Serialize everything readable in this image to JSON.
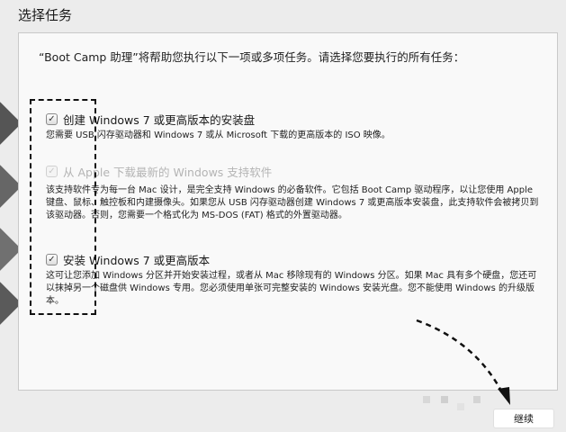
{
  "page": {
    "heading": "选择任务"
  },
  "panel": {
    "intro": "“Boot Camp 助理”将帮助您执行以下一项或多项任务。请选择您要执行的所有任务：",
    "options": [
      {
        "label": "创建 Windows 7 或更高版本的安装盘",
        "checked": true,
        "enabled": true,
        "description": "您需要 USB 闪存驱动器和 Windows 7 或从 Microsoft 下载的更高版本的 ISO 映像。"
      },
      {
        "label": "从 Apple 下载最新的 Windows 支持软件",
        "checked": true,
        "enabled": false,
        "description": "该支持软件专为每一台 Mac 设计，是完全支持 Windows 的必备软件。它包括 Boot Camp 驱动程序，以让您使用 Apple 键盘、鼠标、触控板和内建摄像头。如果您从 USB 闪存驱动器创建 Windows 7 或更高版本安装盘，此支持软件会被拷贝到该驱动器。否则，您需要一个格式化为 MS-DOS (FAT) 格式的外置驱动器。"
      },
      {
        "label": "安装 Windows 7 或更高版本",
        "checked": true,
        "enabled": true,
        "description": "这可让您添加 Windows 分区并开始安装过程，或者从 Mac 移除现有的 Windows 分区。如果 Mac 具有多个硬盘，您还可以抹掉另一个磁盘供 Windows 专用。您必须使用单张可完整安装的 Windows 安装光盘。您不能使用 Windows 的升级版本。"
      }
    ]
  },
  "footer": {
    "continue_label": "继续"
  },
  "icons": {
    "checkmark": "✓"
  }
}
